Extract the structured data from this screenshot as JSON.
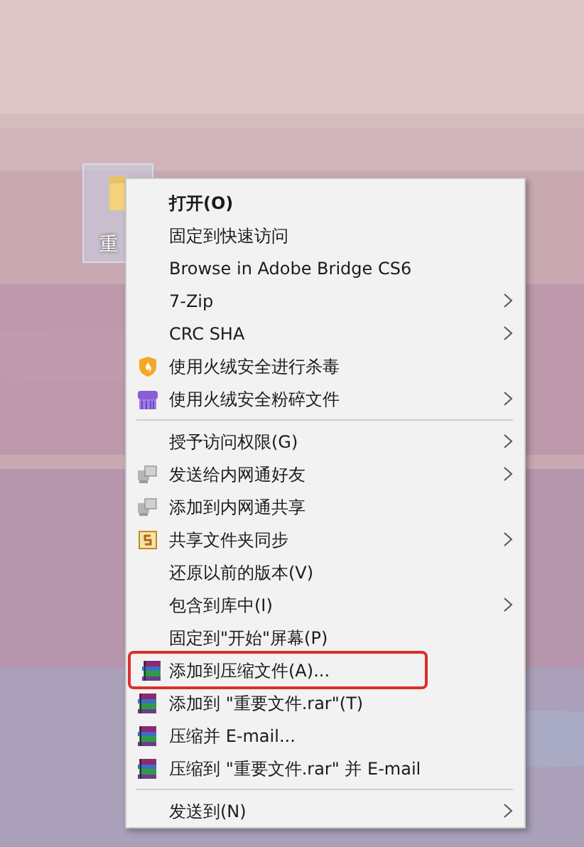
{
  "desktop_icon": {
    "label": "重"
  },
  "context_menu": {
    "sections": [
      {
        "items": [
          {
            "label": "打开(O)",
            "kind": "plain",
            "submenu": false,
            "default": true,
            "highlighted": false
          },
          {
            "label": "固定到快速访问",
            "kind": "plain",
            "submenu": false,
            "default": false,
            "highlighted": false
          },
          {
            "label": "Browse in Adobe Bridge CS6",
            "kind": "plain",
            "submenu": false,
            "default": false,
            "highlighted": false
          },
          {
            "label": "7-Zip",
            "kind": "plain",
            "submenu": true,
            "default": false,
            "highlighted": false
          },
          {
            "label": "CRC SHA",
            "kind": "plain",
            "submenu": true,
            "default": false,
            "highlighted": false
          },
          {
            "label": "使用火绒安全进行杀毒",
            "kind": "shield",
            "submenu": false,
            "default": false,
            "highlighted": false
          },
          {
            "label": "使用火绒安全粉碎文件",
            "kind": "shredder",
            "submenu": true,
            "default": false,
            "highlighted": false
          }
        ]
      },
      {
        "items": [
          {
            "label": "授予访问权限(G)",
            "kind": "plain",
            "submenu": true,
            "default": false,
            "highlighted": false
          },
          {
            "label": "发送给内网通好友",
            "kind": "computers",
            "submenu": true,
            "default": false,
            "highlighted": false
          },
          {
            "label": "添加到内网通共享",
            "kind": "computers",
            "submenu": false,
            "default": false,
            "highlighted": false
          },
          {
            "label": "共享文件夹同步",
            "kind": "sync",
            "submenu": true,
            "default": false,
            "highlighted": false
          },
          {
            "label": "还原以前的版本(V)",
            "kind": "plain",
            "submenu": false,
            "default": false,
            "highlighted": false
          },
          {
            "label": "包含到库中(I)",
            "kind": "plain",
            "submenu": true,
            "default": false,
            "highlighted": false
          },
          {
            "label": "固定到\"开始\"屏幕(P)",
            "kind": "plain",
            "submenu": false,
            "default": false,
            "highlighted": false
          },
          {
            "label": "添加到压缩文件(A)...",
            "kind": "archive",
            "submenu": false,
            "default": false,
            "highlighted": true
          },
          {
            "label": "添加到 \"重要文件.rar\"(T)",
            "kind": "archive",
            "submenu": false,
            "default": false,
            "highlighted": false
          },
          {
            "label": "压缩并 E-mail...",
            "kind": "archive",
            "submenu": false,
            "default": false,
            "highlighted": false
          },
          {
            "label": "压缩到 \"重要文件.rar\" 并 E-mail",
            "kind": "archive",
            "submenu": false,
            "default": false,
            "highlighted": false
          }
        ]
      },
      {
        "items": [
          {
            "label": "发送到(N)",
            "kind": "plain",
            "submenu": true,
            "default": false,
            "highlighted": false
          }
        ]
      }
    ]
  }
}
